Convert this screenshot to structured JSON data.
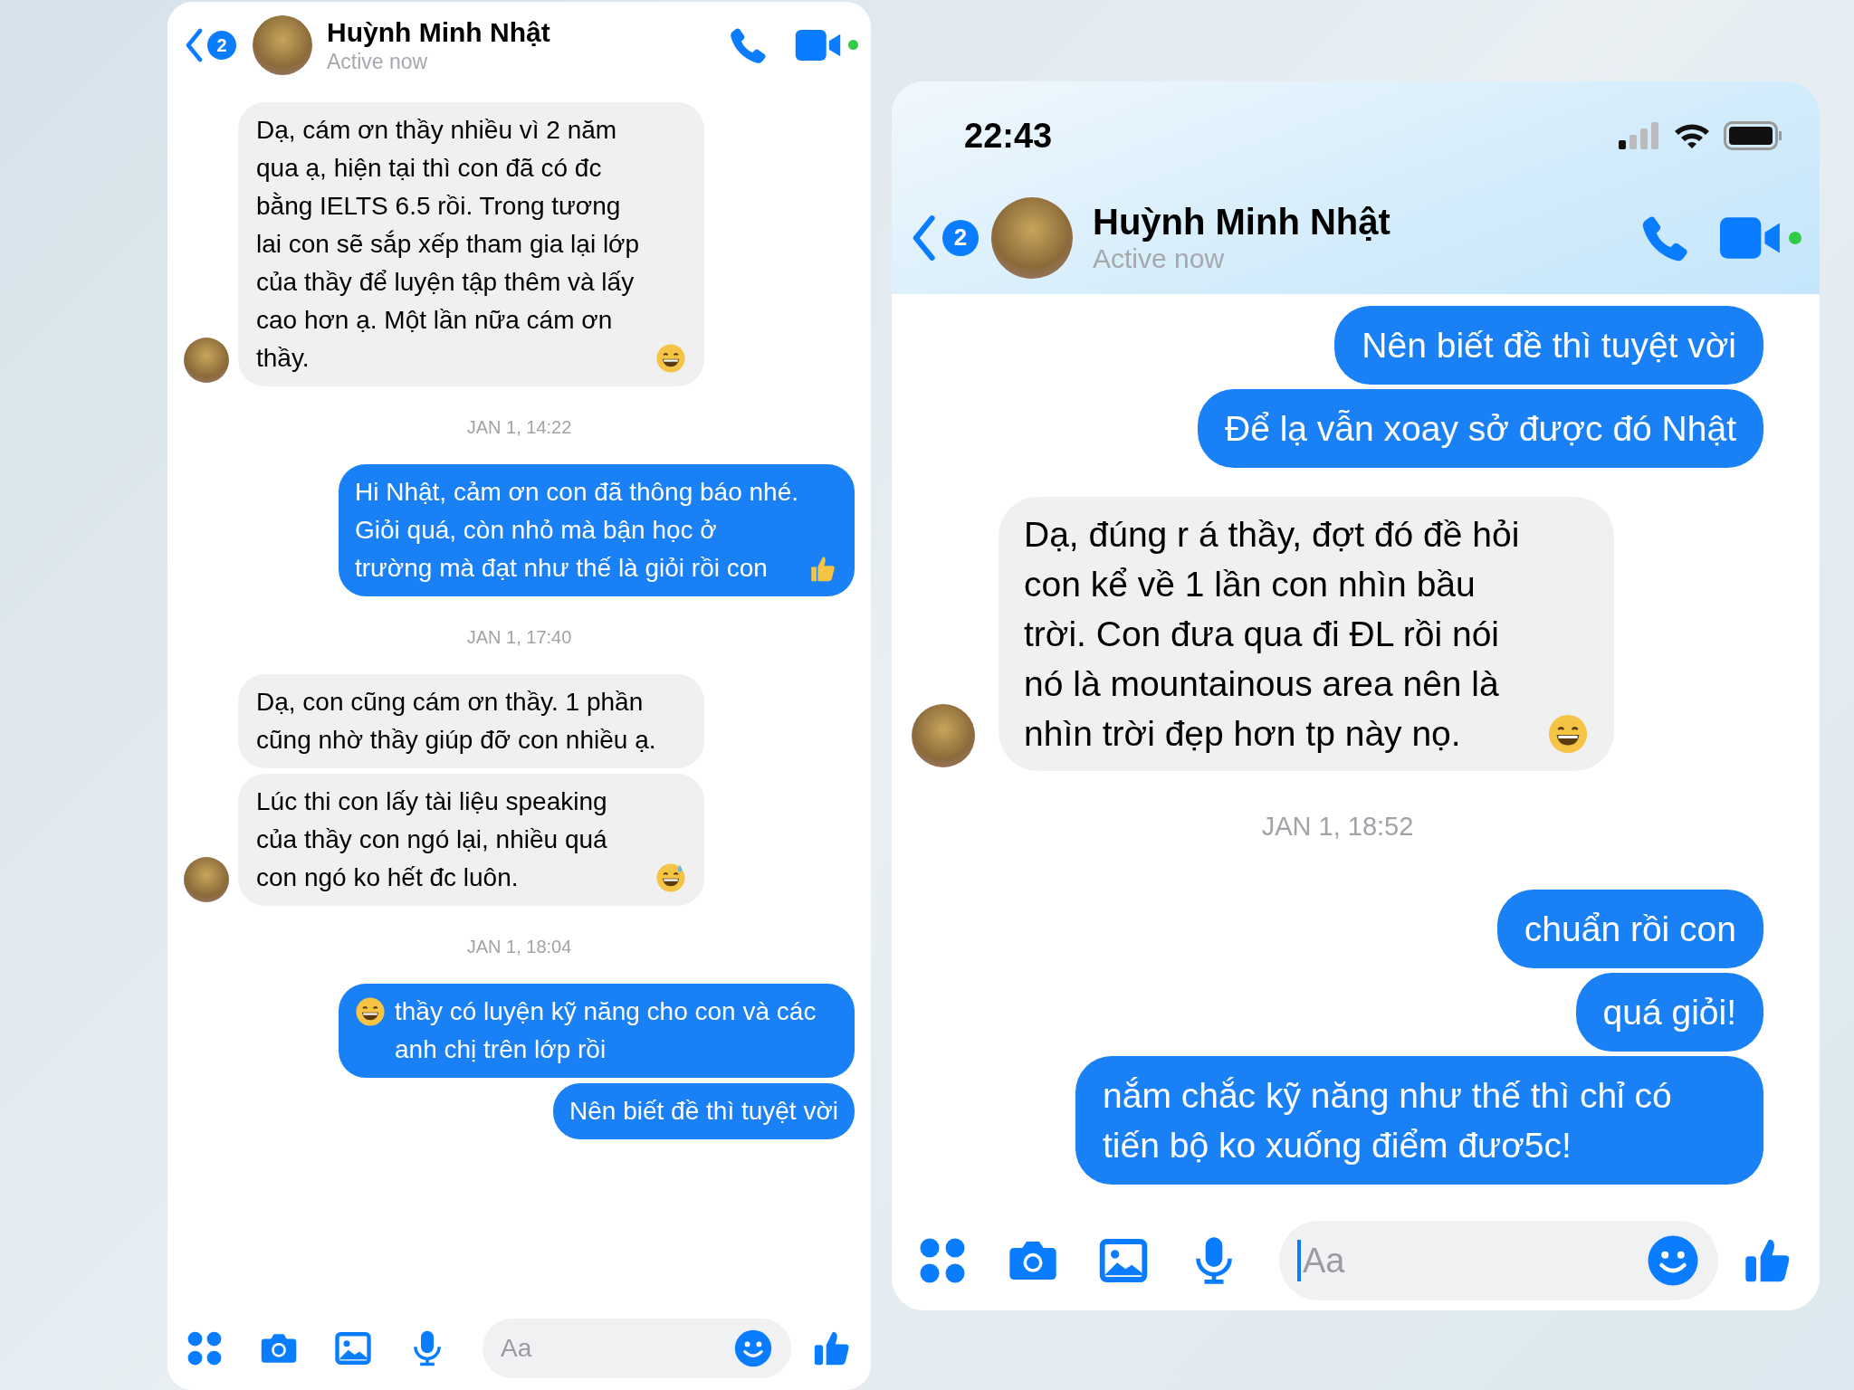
{
  "panels": [
    {
      "header": {
        "back_badge": "2",
        "name": "Huỳnh Minh Nhật",
        "status": "Active now",
        "online": true
      },
      "messages": [
        {
          "kind": "incoming",
          "parts": [
            {
              "kind": "text",
              "text": "Dạ, cám ơn thầy nhiều vì 2 năm qua ạ, hiện tại thì con đã có đc bằng IELTS 6.5 rồi. Trong tương lai con sẽ sắp xếp tham gia lại lớp của thầy để luyện tập thêm và lấy cao hơn ạ. Một lần nữa cám ơn thầy."
            },
            {
              "kind": "grin"
            }
          ],
          "avatar": true
        },
        {
          "kind": "date",
          "text": "JAN 1, 14:22"
        },
        {
          "kind": "outgoing",
          "parts": [
            {
              "kind": "text",
              "text": "Hi Nhật, cảm ơn con đã thông báo nhé. Giỏi quá, còn nhỏ mà bận học ở trường mà đạt như thế là giỏi rồi con"
            },
            {
              "kind": "thumbs"
            }
          ]
        },
        {
          "kind": "date",
          "text": "JAN 1, 17:40"
        },
        {
          "kind": "incoming",
          "parts": [
            {
              "kind": "text",
              "text": "Dạ, con cũng cám ơn thầy. 1 phần cũng nhờ thầy giúp đỡ con nhiều ạ."
            }
          ],
          "avatar": false
        },
        {
          "kind": "incoming",
          "parts": [
            {
              "kind": "text",
              "text": "Lúc thi con lấy tài liệu speaking của thầy con ngó lại, nhiều quá con ngó ko hết đc luôn."
            },
            {
              "kind": "sweat"
            }
          ],
          "avatar": true
        },
        {
          "kind": "date",
          "text": "JAN 1, 18:04"
        },
        {
          "kind": "outgoing",
          "parts": [
            {
              "kind": "grin"
            },
            {
              "kind": "text",
              "text": "thầy có luyện kỹ năng cho con và các anh chị trên lớp rồi"
            }
          ]
        },
        {
          "kind": "outgoing",
          "parts": [
            {
              "kind": "text",
              "text": "Nên biết đề thì tuyệt vời"
            }
          ]
        }
      ],
      "composer": {
        "placeholder": "Aa",
        "focused": false
      }
    },
    {
      "status_bar": {
        "time": "22:43"
      },
      "header": {
        "back_badge": "2",
        "name": "Huỳnh Minh Nhật",
        "status": "Active now",
        "online": true
      },
      "messages": [
        {
          "kind": "outgoing",
          "parts": [
            {
              "kind": "text",
              "text": "Nên biết đề thì tuyệt vời"
            }
          ]
        },
        {
          "kind": "outgoing",
          "parts": [
            {
              "kind": "text",
              "text": "Để lạ vẫn xoay sở được đó Nhật"
            }
          ]
        },
        {
          "kind": "incoming",
          "parts": [
            {
              "kind": "text",
              "text": "Dạ, đúng r á thầy, đợt đó đề hỏi con kể về 1 lần con nhìn bầu trời. Con đưa qua đi ĐL rồi nói nó là mountainous area  nên là nhìn trời đẹp hơn tp này nọ."
            },
            {
              "kind": "grin"
            }
          ],
          "avatar": true
        },
        {
          "kind": "date",
          "text": "JAN 1, 18:52"
        },
        {
          "kind": "outgoing",
          "parts": [
            {
              "kind": "text",
              "text": "chuẩn rồi con"
            }
          ]
        },
        {
          "kind": "outgoing",
          "parts": [
            {
              "kind": "text",
              "text": "quá giỏi!"
            }
          ]
        },
        {
          "kind": "outgoing",
          "parts": [
            {
              "kind": "text",
              "text": "nắm chắc kỹ năng như thế thì chỉ có tiến bộ ko xuống điểm đươ5c!"
            }
          ]
        }
      ],
      "composer": {
        "placeholder": "Aa",
        "focused": true
      }
    }
  ]
}
